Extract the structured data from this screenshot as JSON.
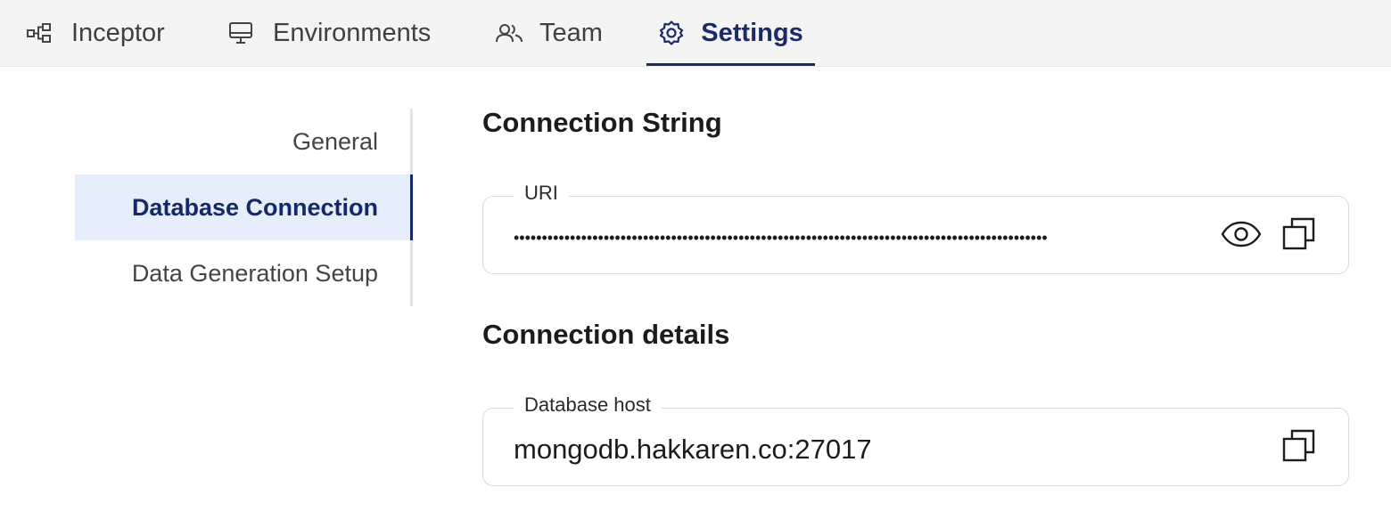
{
  "tabs": [
    {
      "label": "Inceptor",
      "icon": "diagram-icon",
      "active": false
    },
    {
      "label": "Environments",
      "icon": "monitor-icon",
      "active": false
    },
    {
      "label": "Team",
      "icon": "users-icon",
      "active": false
    },
    {
      "label": "Settings",
      "icon": "gear-icon",
      "active": true
    }
  ],
  "sidebar": {
    "items": [
      {
        "label": "General",
        "active": false
      },
      {
        "label": "Database Connection",
        "active": true
      },
      {
        "label": "Data Generation Setup",
        "active": false
      }
    ]
  },
  "connection_string": {
    "title": "Connection String",
    "uri_label": "URI",
    "uri_masked": "•••••••••••••••••••••••••••••••••••••••••••••••••••••••••••••••••••••••••••••••••••••••••••••••",
    "show_icon": "eye-icon",
    "copy_icon": "copy-icon"
  },
  "connection_details": {
    "title": "Connection details",
    "host_label": "Database host",
    "host_value": "mongodb.hakkaren.co:27017",
    "copy_icon": "copy-icon"
  },
  "colors": {
    "accent": "#1a2a6c",
    "active_bg": "#e6edfb",
    "topbar_bg": "#f4f4f4"
  }
}
